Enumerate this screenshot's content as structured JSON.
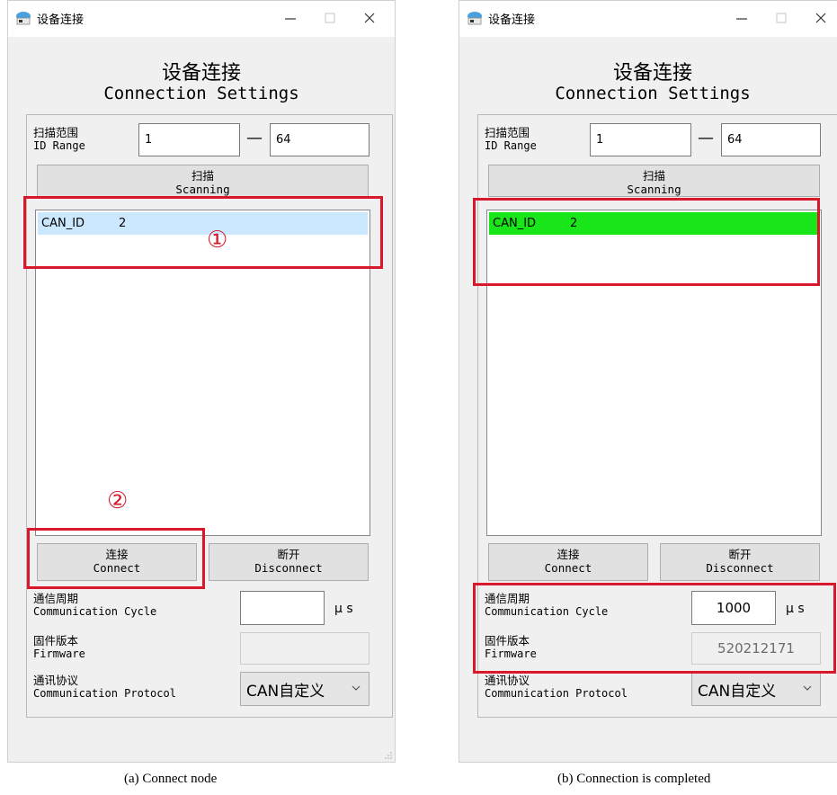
{
  "panels": [
    {
      "id": "a",
      "window_title": "设备连接",
      "heading_cn": "设备连接",
      "heading_en": "Connection Settings",
      "id_range": {
        "label_cn": "扫描范围",
        "label_en": "ID Range",
        "from": "1",
        "dash": "—",
        "to": "64"
      },
      "scan_button": {
        "cn": "扫描",
        "en": "Scanning"
      },
      "list_items": [
        {
          "key": "CAN_ID",
          "value": "2",
          "state": "selected"
        }
      ],
      "connect_button": {
        "cn": "连接",
        "en": "Connect"
      },
      "disconnect_button": {
        "cn": "断开",
        "en": "Disconnect"
      },
      "cycle": {
        "label_cn": "通信周期",
        "label_en": "Communication Cycle",
        "value": "",
        "unit": "µ s"
      },
      "firmware": {
        "label_cn": "固件版本",
        "label_en": "Firmware",
        "value": ""
      },
      "protocol": {
        "label_cn": "通讯协议",
        "label_en": "Communication Protocol",
        "value": "CAN自定义"
      },
      "markers": [
        "①",
        "②"
      ],
      "caption": "(a)  Connect node"
    },
    {
      "id": "b",
      "window_title": "设备连接",
      "heading_cn": "设备连接",
      "heading_en": "Connection Settings",
      "id_range": {
        "label_cn": "扫描范围",
        "label_en": "ID Range",
        "from": "1",
        "dash": "—",
        "to": "64"
      },
      "scan_button": {
        "cn": "扫描",
        "en": "Scanning"
      },
      "list_items": [
        {
          "key": "CAN_ID",
          "value": "2",
          "state": "connected"
        }
      ],
      "connect_button": {
        "cn": "连接",
        "en": "Connect"
      },
      "disconnect_button": {
        "cn": "断开",
        "en": "Disconnect"
      },
      "cycle": {
        "label_cn": "通信周期",
        "label_en": "Communication Cycle",
        "value": "1000",
        "unit": "µ s"
      },
      "firmware": {
        "label_cn": "固件版本",
        "label_en": "Firmware",
        "value": "520212171"
      },
      "protocol": {
        "label_cn": "通讯协议",
        "label_en": "Communication Protocol",
        "value": "CAN自定义"
      },
      "markers": [],
      "caption": "(b)  Connection is completed"
    }
  ],
  "colors": {
    "selected_row": "#cce8ff",
    "connected_row": "#19e619",
    "annotation_red": "#d7192b",
    "window_bg": "#f0f0f0"
  },
  "icons": [
    "app-icon",
    "minimize-icon",
    "maximize-icon",
    "close-icon",
    "chevron-down-icon",
    "resize-grip-icon"
  ]
}
